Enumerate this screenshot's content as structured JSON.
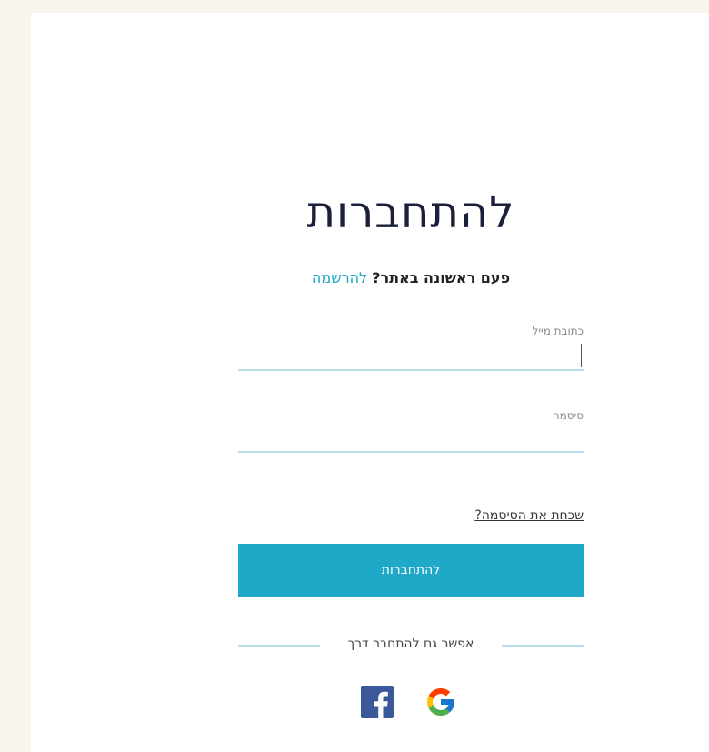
{
  "login": {
    "title": "להתחברות",
    "subtitle_question": "פעם ראשונה באתר?",
    "subtitle_link": "להרשמה",
    "email_label": "כתובת מייל",
    "email_value": "",
    "password_label": "סיסמה",
    "password_value": "",
    "forgot_link": "שכחת את הסיסמה?",
    "submit_label": "להתחברות",
    "divider_text": "אפשר גם להתחבר דרך",
    "social": [
      {
        "name": "Facebook",
        "icon": "facebook-icon",
        "color": "#3b5998"
      },
      {
        "name": "Google",
        "icon": "google-icon",
        "color": "#4285f4"
      }
    ]
  },
  "colors": {
    "accent": "#1fa8c7",
    "link": "#20a7c6",
    "input_underline": "#b9dcec",
    "page_bg": "#f8f5ef",
    "title": "#1a1f3a"
  }
}
